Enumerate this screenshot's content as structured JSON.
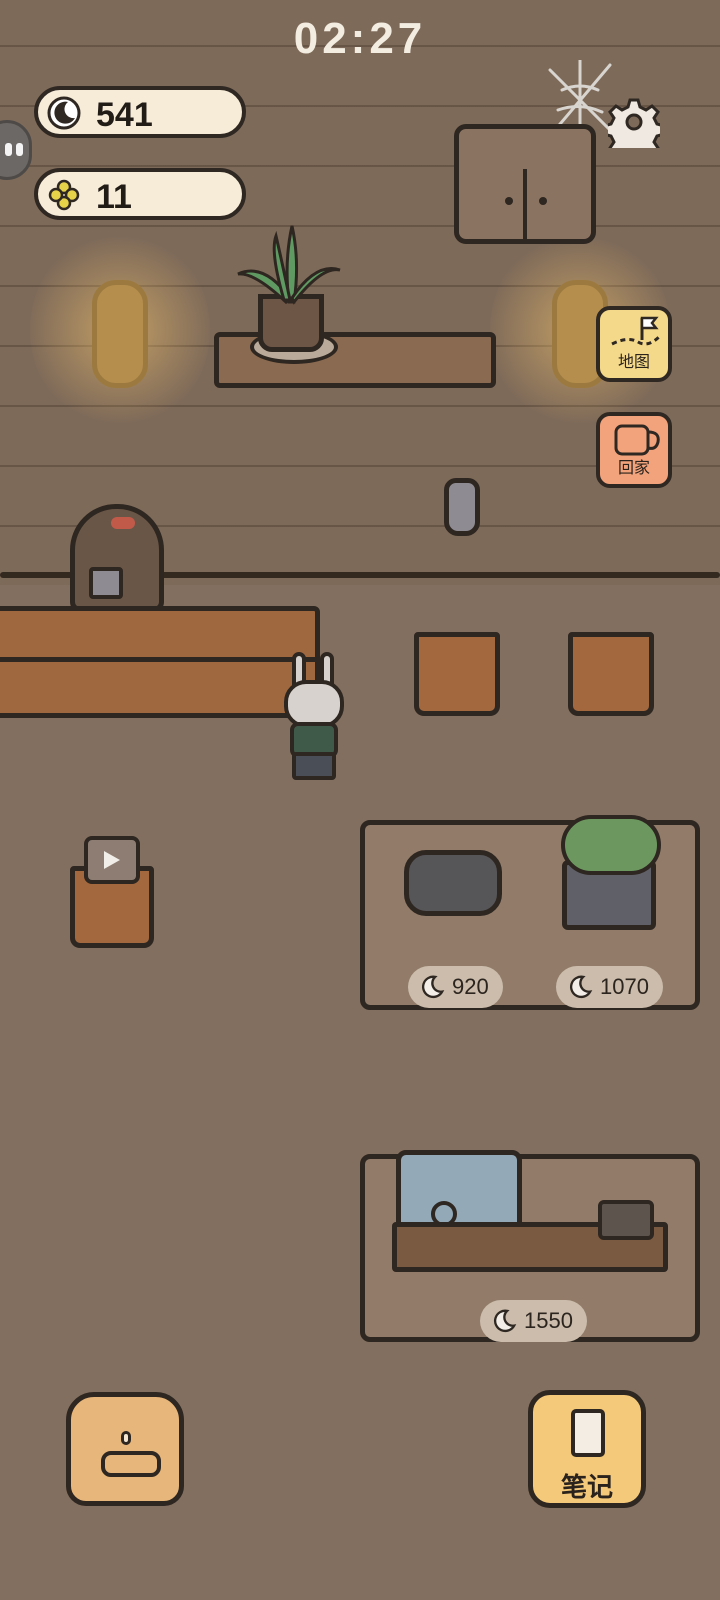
{
  "clock": {
    "time": "02:27"
  },
  "currency": {
    "moons": "541",
    "clovers": "11"
  },
  "side_buttons": {
    "map_label": "地图",
    "home_label": "回家"
  },
  "shop_items": [
    {
      "price": "920"
    },
    {
      "price": "1070"
    },
    {
      "price": "1550"
    }
  ],
  "notes_button": {
    "label": "笔记"
  },
  "colors": {
    "wall": "#7e6a59",
    "floor": "#836f5f",
    "outline": "#2e2620",
    "pill": "#f7ecd8",
    "map_button": "#f5d98a",
    "home_button": "#f2a37c",
    "notes_button": "#f5c97a"
  },
  "icons": {
    "moon": "moon-icon",
    "clover": "clover-icon",
    "settings": "gear-icon",
    "map": "map-flag-icon",
    "home": "cup-icon",
    "bag": "backpack-icon",
    "notes": "notebook-icon",
    "video": "video-play-icon"
  }
}
